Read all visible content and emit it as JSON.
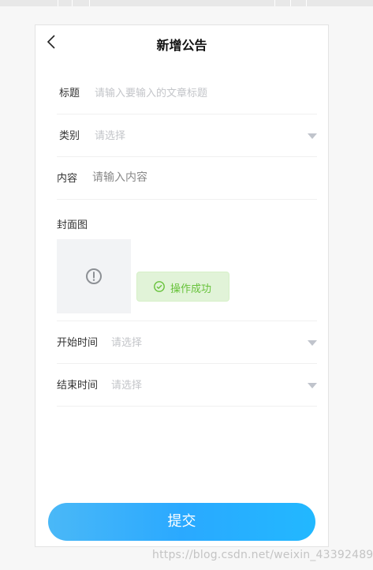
{
  "page": {
    "title": "新增公告",
    "submit_label": "提交",
    "watermark": "https://blog.csdn.net/weixin_43392489"
  },
  "form": {
    "title_label": "标题",
    "title_placeholder": "请输入要输入的文章标题",
    "category_label": "类别",
    "category_placeholder": "请选择",
    "content_label": "内容",
    "content_placeholder": "请输入内容",
    "cover_label": "封面图",
    "start_label": "开始时间",
    "start_placeholder": "请选择",
    "end_label": "结束时间",
    "end_placeholder": "请选择"
  },
  "toast": {
    "message": "操作成功"
  },
  "icons": {
    "back": "back-arrow-icon",
    "dropdown": "caret-down-icon",
    "cover_placeholder": "exclamation-circle-icon",
    "success": "check-circle-icon"
  },
  "colors": {
    "accent": "#2aa9ff",
    "success": "#67c23a",
    "success_bg": "#e1f3d8",
    "placeholder": "#c3c5c9"
  }
}
